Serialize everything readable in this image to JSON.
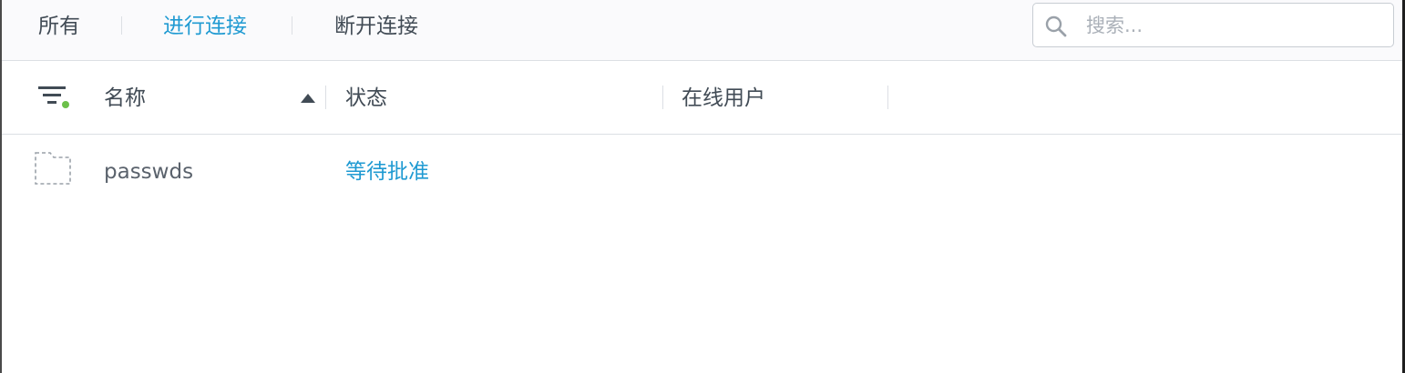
{
  "toolbar": {
    "tabs": [
      {
        "label": "所有",
        "active": false
      },
      {
        "label": "进行连接",
        "active": true
      },
      {
        "label": "断开连接",
        "active": false
      }
    ],
    "search": {
      "placeholder": "搜索..."
    }
  },
  "table": {
    "columns": [
      {
        "label": "名称",
        "sorted": "ascending"
      },
      {
        "label": "状态"
      },
      {
        "label": "在线用户"
      }
    ],
    "filter_active": true,
    "rows": [
      {
        "name": "passwds",
        "status": "等待批准",
        "online_users": ""
      }
    ]
  },
  "colors": {
    "accent": "#1f9ad2",
    "text": "#414b55",
    "filter_dot": "#6cc04a"
  },
  "icons": [
    "search-icon",
    "filter-icon",
    "sort-ascending-icon",
    "folder-placeholder-icon"
  ]
}
